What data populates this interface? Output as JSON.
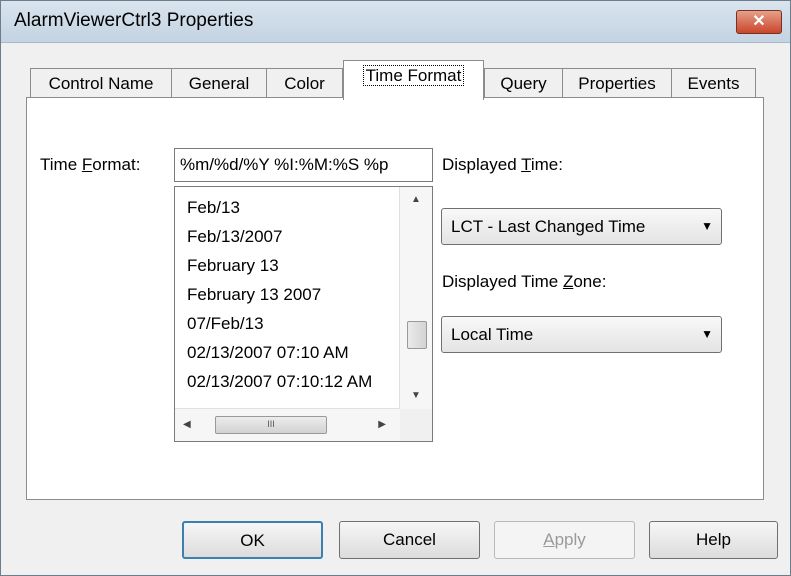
{
  "window": {
    "title": "AlarmViewerCtrl3 Properties",
    "close_glyph": "✕"
  },
  "tabs": [
    {
      "label": "Control Name"
    },
    {
      "label": "General"
    },
    {
      "label": "Color"
    },
    {
      "label": "Time Format",
      "active": true
    },
    {
      "label": "Query"
    },
    {
      "label": "Properties"
    },
    {
      "label": "Events"
    }
  ],
  "time_format": {
    "label_pre": "Time ",
    "label_mnemonic": "F",
    "label_post": "ormat:",
    "value": "%m/%d/%Y %I:%M:%S %p",
    "options": [
      "Feb/13",
      "Feb/13/2007",
      "February 13",
      "February 13 2007",
      "07/Feb/13",
      "02/13/2007 07:10 AM",
      "02/13/2007 07:10:12 AM"
    ]
  },
  "displayed_time": {
    "label_pre": "Displayed ",
    "label_mnemonic": "T",
    "label_post": "ime:",
    "value": "LCT - Last Changed Time"
  },
  "displayed_time_zone": {
    "label_pre": "Displayed Time ",
    "label_mnemonic": "Z",
    "label_post": "one:",
    "value": "Local Time"
  },
  "buttons": {
    "ok": "OK",
    "cancel": "Cancel",
    "apply_mnemonic": "A",
    "apply_rest": "pply",
    "help": "Help"
  },
  "icons": {
    "scroll_up": "▲",
    "scroll_down": "▼",
    "scroll_left": "◀",
    "scroll_right": "▶",
    "dropdown_arrow": "▼",
    "grip": "III"
  },
  "colors": {
    "default_button_border": "#3c7fb1",
    "close_button": "#c9452b"
  }
}
